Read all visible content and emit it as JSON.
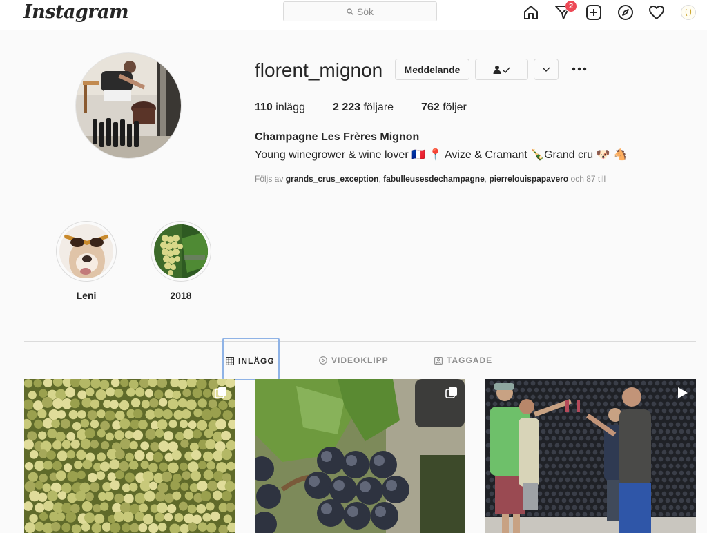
{
  "nav": {
    "logo": "Instagram",
    "search_placeholder": "Sök",
    "notification_count": "2"
  },
  "profile": {
    "username": "florent_mignon",
    "message_button": "Meddelande",
    "stats": {
      "posts_count": "110",
      "posts_label": " inlägg",
      "followers_count": "2 223",
      "followers_label": " följare",
      "following_count": "762",
      "following_label": " följer"
    },
    "full_name": "Champagne Les Frères Mignon",
    "bio": "Young winegrower & wine lover 🇫🇷 📍 Avize & Cramant 🍾Grand cru 🐶 🐴",
    "followed_by_prefix": "Följs av ",
    "followed_by_users": [
      "grands_crus_exception",
      "fabulleusesdechampagne",
      "pierrelouispapavero"
    ],
    "followed_by_suffix": " och 87 till"
  },
  "highlights": [
    {
      "label": "Leni"
    },
    {
      "label": "2018"
    }
  ],
  "tabs": [
    {
      "label": "INLÄGG",
      "icon": "grid-icon",
      "active": true
    },
    {
      "label": "VIDEOKLIPP",
      "icon": "play-circle-icon",
      "active": false
    },
    {
      "label": "TAGGADE",
      "icon": "tagged-icon",
      "active": false
    }
  ],
  "posts": [
    {
      "subject": "green grapes",
      "type_icon": "carousel-icon"
    },
    {
      "subject": "dark grapes with leaves",
      "type_icon": "carousel-icon"
    },
    {
      "subject": "wine cellar toast",
      "type_icon": "video-icon"
    }
  ],
  "colors": {
    "badge": "#ed4956",
    "text": "#262626",
    "secondary": "#8e8e8e",
    "border": "#dbdbdb",
    "focus": "#8fb3e6"
  }
}
